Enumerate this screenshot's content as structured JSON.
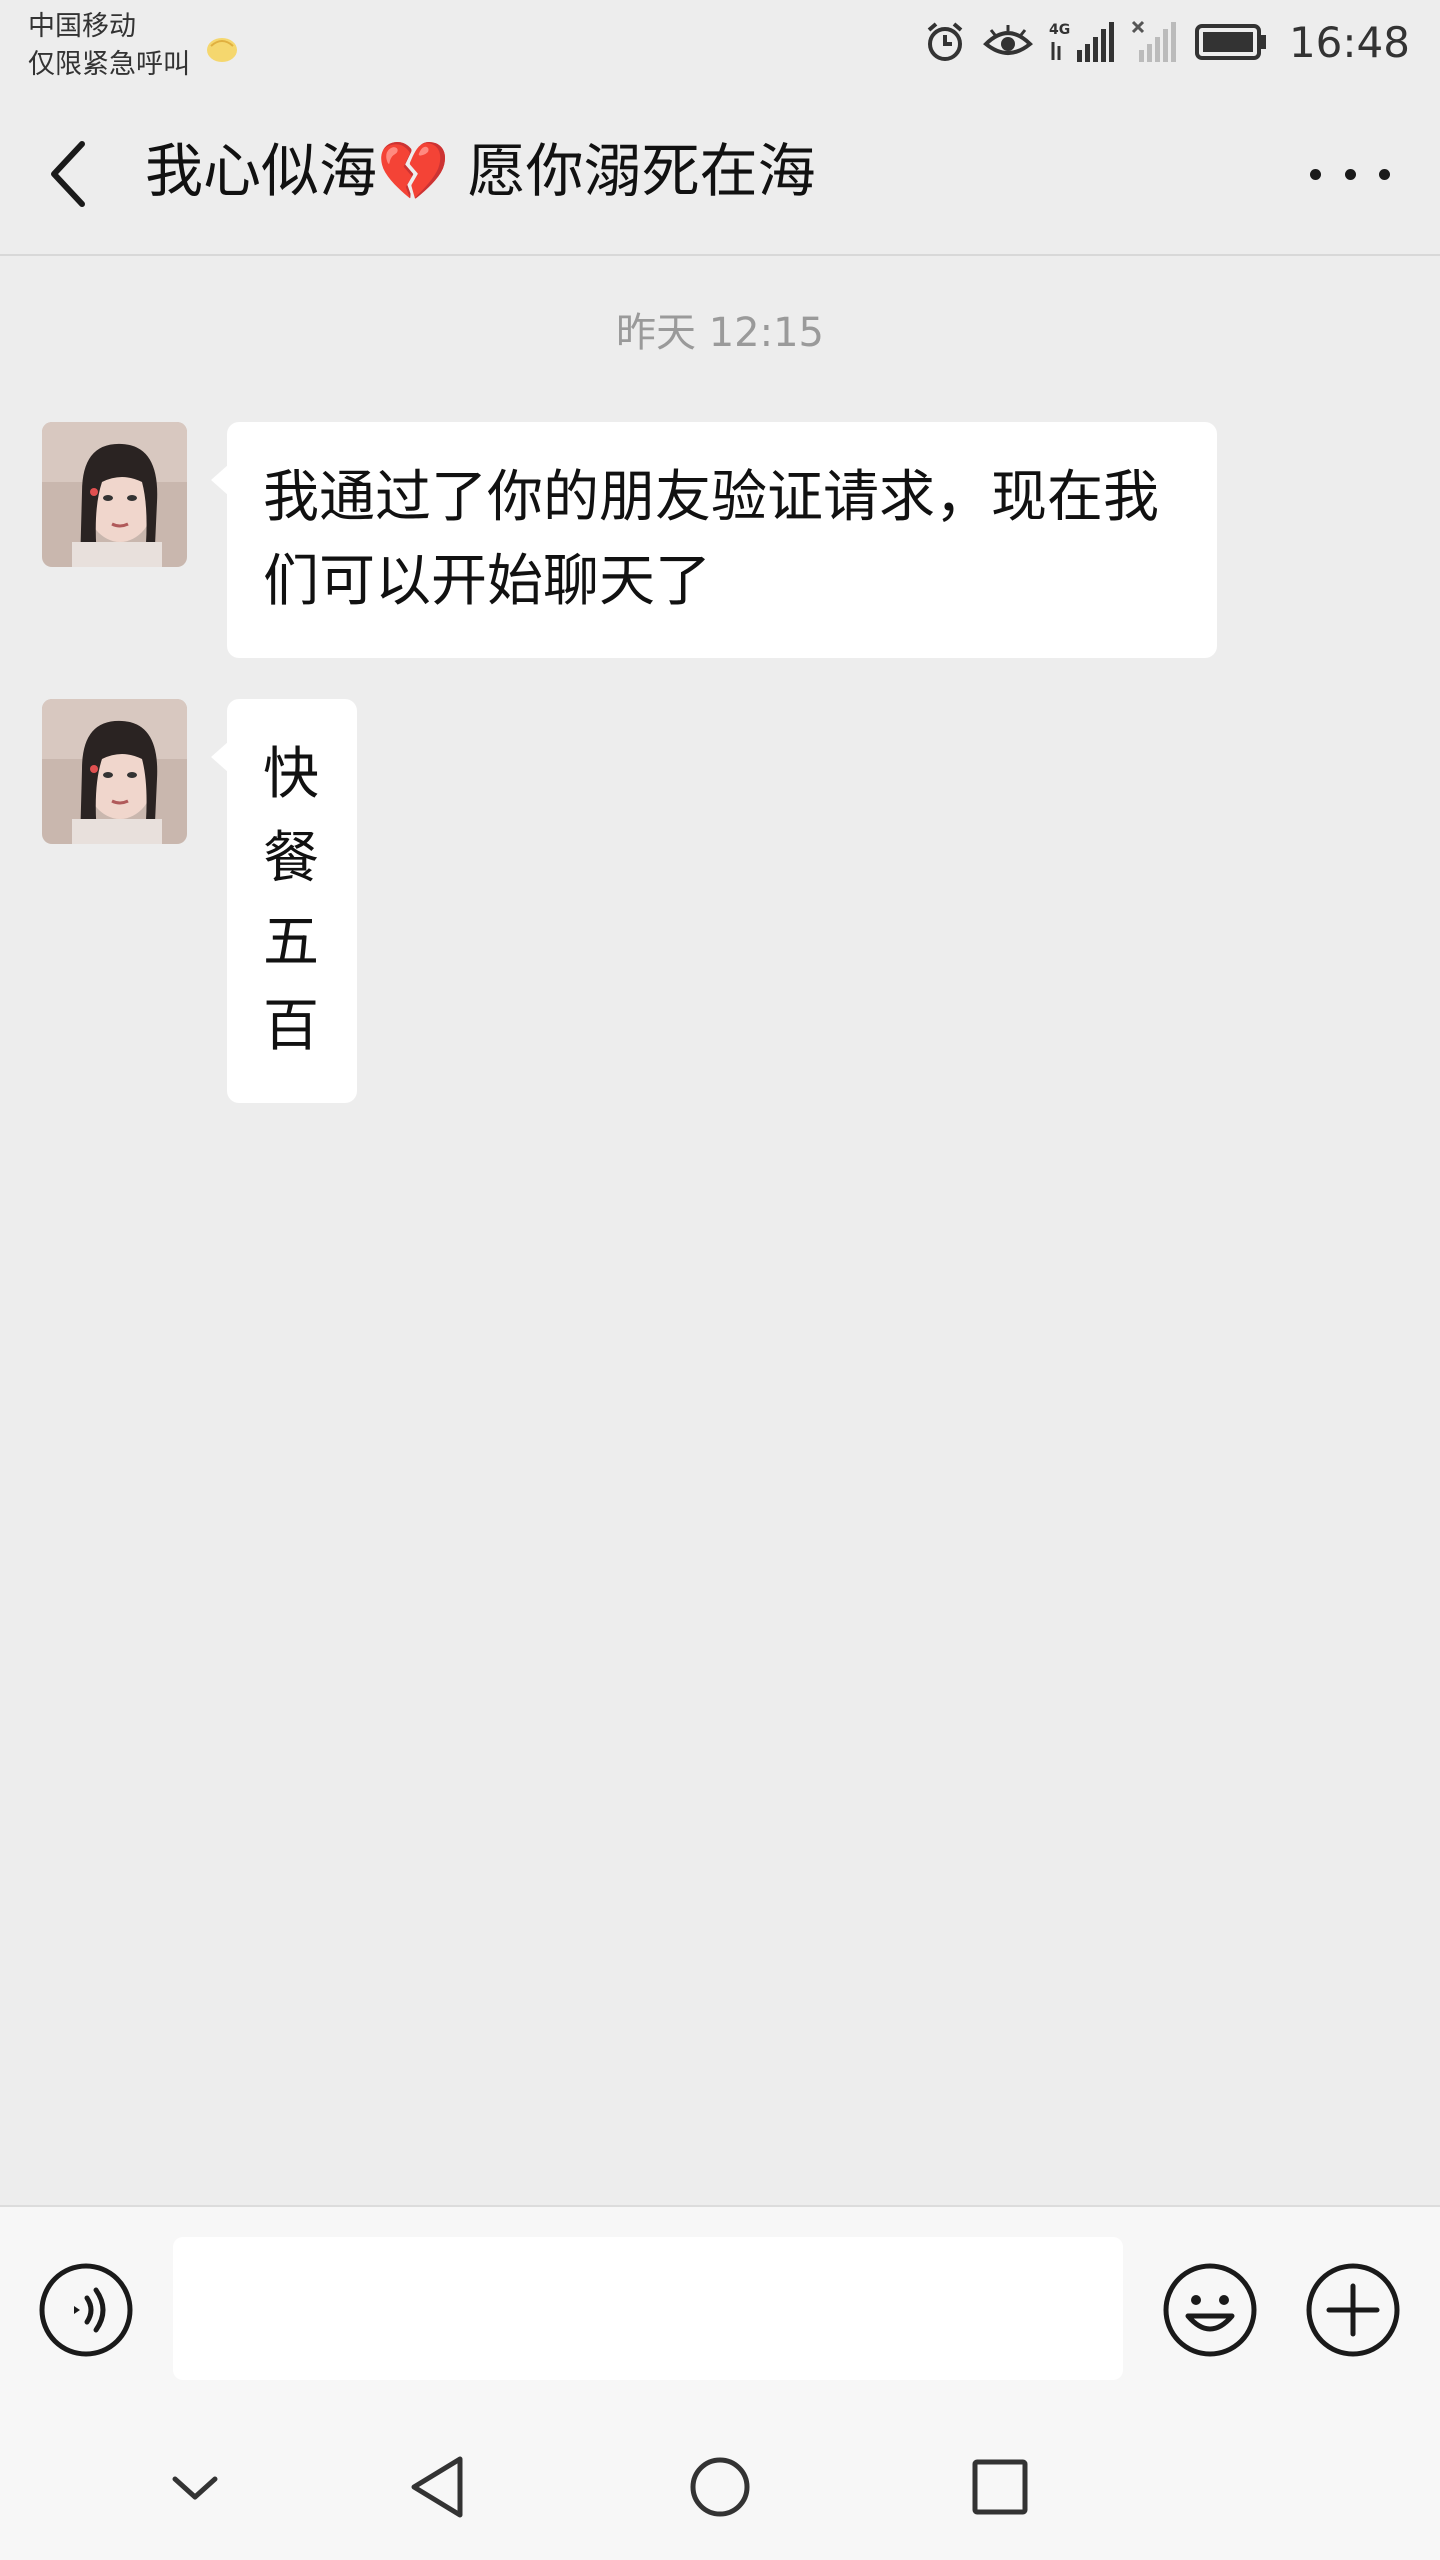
{
  "status_bar": {
    "carrier_line1": "中国移动",
    "carrier_line2": "仅限紧急呼叫",
    "network": "4G",
    "time": "16:48",
    "icons": [
      "alarm-icon",
      "eye-icon",
      "signal-4g-icon",
      "signal-no-sim-icon",
      "battery-icon"
    ]
  },
  "header": {
    "title": "我心似海💔 愿你溺死在海",
    "back_icon": "chevron-left-icon",
    "more_icon": "more-dots-icon"
  },
  "chat": {
    "timestamp": "昨天 12:15",
    "messages": [
      {
        "sender": "contact",
        "text": "我通过了你的朋友验证请求，现在我们可以开始聊天了"
      },
      {
        "sender": "contact",
        "text": "快餐五百"
      }
    ]
  },
  "input_bar": {
    "value": "",
    "placeholder": "",
    "icons": [
      "voice-icon",
      "emoji-icon",
      "plus-icon"
    ]
  },
  "nav_bar": {
    "icons": [
      "chevron-down-icon",
      "triangle-back-icon",
      "circle-home-icon",
      "square-recent-icon"
    ]
  },
  "colors": {
    "background": "#ededed",
    "bubble": "#ffffff",
    "bar": "#f7f7f7",
    "timestamp": "#9a9a9a"
  }
}
